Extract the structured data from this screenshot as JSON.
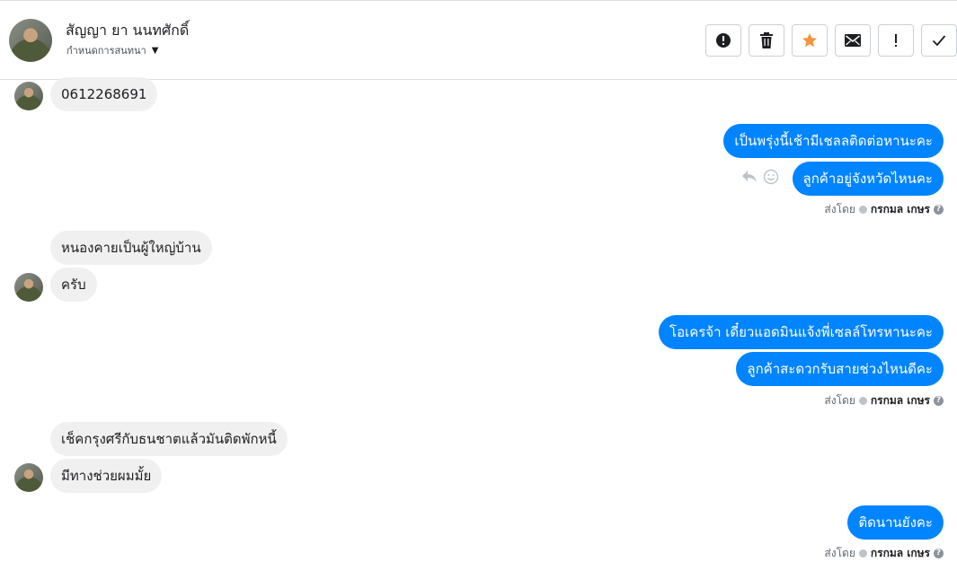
{
  "header": {
    "contact_name": "สัญญา ยา นนทศักดิ์",
    "label_dropdown": "กำหนดการสนทนา"
  },
  "toolbar": {
    "buttons": [
      {
        "name": "spam",
        "icon": "alert-circle-icon"
      },
      {
        "name": "delete",
        "icon": "trash-icon"
      },
      {
        "name": "star",
        "icon": "star-icon",
        "color": "#f7923b"
      },
      {
        "name": "mark-unread",
        "icon": "envelope-icon"
      },
      {
        "name": "follow-up",
        "icon": "exclamation-icon"
      },
      {
        "name": "done",
        "icon": "check-icon"
      }
    ]
  },
  "messages": {
    "m1": "0612268691",
    "m2": "เป็นพรุ่งนี้เช้ามีเชลลติดต่อหานะคะ",
    "m3": "ลูกค้าอยู่จังหวัดไหนคะ",
    "m4": "หนองคายเป็นผู้ใหญ่บ้าน",
    "m5": "ครับ",
    "m6": "โอเครจ้า เดี๋ยวแอดมินแจ้งพี่เซลล์โทรหานะคะ",
    "m7": "ลูกค้าสะดวกรับสายช่วงไหนดีคะ",
    "m8": "เช็คกรุงศรีกับธนชาตแล้วมันติดพักหนี้",
    "m9": "มีทางช่วยผมมั้ย",
    "m10": "ติดนานยังคะ"
  },
  "sent_by": {
    "prefix": "ส่งโดย",
    "name": "กรกมล เกษร",
    "help": "?"
  },
  "colors": {
    "outgoing_bubble": "#0084ff",
    "incoming_bubble": "#f1f0f0"
  }
}
